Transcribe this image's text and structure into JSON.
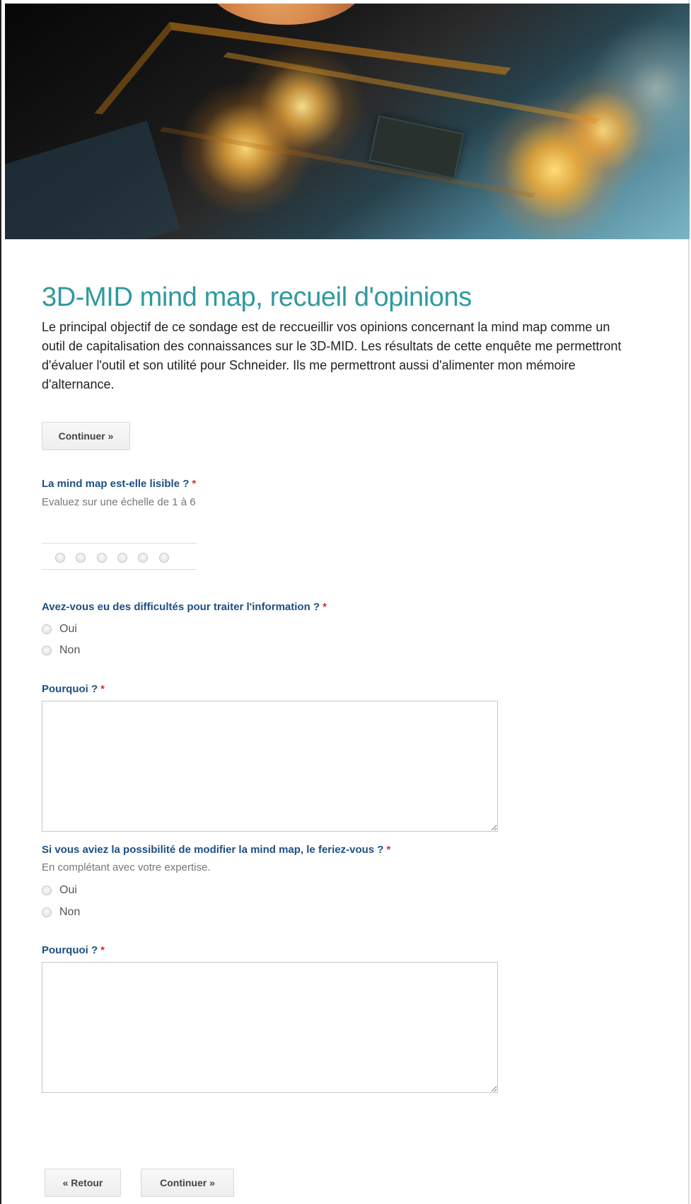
{
  "survey": {
    "title": "3D-MID mind map, recueil d'opinions",
    "intro": "Le principal objectif de ce sondage est de reccueillir vos opinions concernant la mind map comme un outil de capitalisation des connaissances sur le 3D-MID. Les résultats de cette enquête me permettront d'évaluer l'outil et son utilité pour Schneider. Ils me permettront aussi d'alimenter mon mémoire d'alternance."
  },
  "actions": {
    "continue_top": "Continuer »",
    "back": "« Retour",
    "continue_bottom": "Continuer »"
  },
  "questions": {
    "lisibility": {
      "label": "La mind map est-elle lisible ?",
      "required": "*",
      "help": "Evaluez sur une échelle de 1 à 6",
      "scale": [
        "1",
        "2",
        "3",
        "4",
        "5",
        "6"
      ]
    },
    "difficulties": {
      "label": "Avez-vous eu des difficultés pour traiter l'information ?",
      "required": "*",
      "options": [
        "Oui",
        "Non"
      ]
    },
    "why_difficulties": {
      "label": "Pourquoi ?",
      "required": "*",
      "value": ""
    },
    "modify": {
      "label": "Si vous aviez la possibilité de modifier la mind map, le feriez-vous ?",
      "required": "*",
      "help": "En complétant avec votre expertise.",
      "options": [
        "Oui",
        "Non"
      ]
    },
    "why_modify": {
      "label": "Pourquoi ?",
      "required": "*",
      "value": ""
    }
  }
}
